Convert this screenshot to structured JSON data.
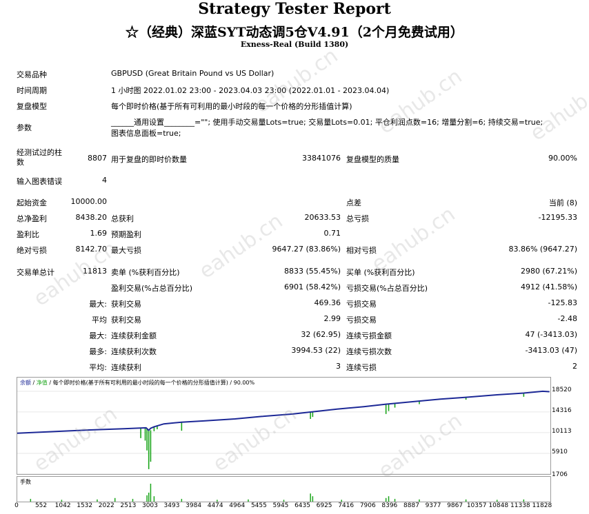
{
  "header": {
    "title": "Strategy Tester Report",
    "subtitle": "☆（经典）深蓝SYT动态调5仓V4.91（2个月免费试用）",
    "server": "Exness-Real (Build 1380)"
  },
  "info": {
    "symbol_label": "交易品种",
    "symbol_value": "GBPUSD (Great Britain Pound vs US Dollar)",
    "period_label": "时间周期",
    "period_value": "1 小时图 2022.01.02 23:00 - 2023.04.03 23:00 (2022.01.01 - 2023.04.04)",
    "model_label": "复盘模型",
    "model_value": "每个即时价格(基于所有可利用的最小时段的每一个价格的分形插值计算)",
    "params_label": "参数",
    "params_line1": "______通用设置________=\"\"; 使用手动交易量Lots=true; 交易量Lots=0.01; 平仓利润点数=16; 增量分割=6; 持续交易=true;",
    "params_line2": "图表信息面板=true;"
  },
  "stats": {
    "bars_label": "经测试过的柱\n数",
    "bars_value": "8807",
    "ticks_label": "用于复盘的即时价数量",
    "ticks_value": "33841076",
    "quality_label": "复盘模型的质量",
    "quality_value": "90.00%",
    "errors_label": "输入图表错误",
    "errors_value": "4",
    "deposit_label": "起始资金",
    "deposit_value": "10000.00",
    "spread_label": "点差",
    "spread_value": "当前 (8)",
    "net_label": "总净盈利",
    "net_value": "8438.20",
    "gross_profit_label": "总获利",
    "gross_profit_value": "20633.53",
    "gross_loss_label": "总亏损",
    "gross_loss_value": "-12195.33",
    "pf_label": "盈利比",
    "pf_value": "1.69",
    "payoff_label": "预期盈利",
    "payoff_value": "0.71",
    "abs_dd_label": "绝对亏损",
    "abs_dd_value": "8142.70",
    "max_dd_label": "最大亏损",
    "max_dd_value": "9647.27 (83.86%)",
    "rel_dd_label": "相对亏损",
    "rel_dd_value": "83.86% (9647.27)",
    "trades_label": "交易单总计",
    "trades_value": "11813",
    "short_label": "卖单 (%获利百分比)",
    "short_value": "8833 (55.45%)",
    "long_label": "买单 (%获利百分比)",
    "long_value": "2980 (67.21%)",
    "win_label": "盈利交易(%占总百分比)",
    "win_value": "6901 (58.42%)",
    "loss_label": "亏损交易(%占总百分比)",
    "loss_value": "4912 (41.58%)",
    "max_label": "最大:",
    "max_win_label": "获利交易",
    "max_win_value": "469.36",
    "max_loss_label": "亏损交易",
    "max_loss_value": "-125.83",
    "avg_label": "平均",
    "avg_win_label": "获利交易",
    "avg_win_value": "2.99",
    "avg_loss_label": "亏损交易",
    "avg_loss_value": "-2.48",
    "maxc_label": "最大:",
    "maxc_win_label": "连续获利金额",
    "maxc_win_value": "32 (62.95)",
    "maxc_loss_label": "连续亏损金额",
    "maxc_loss_value": "47 (-3413.03)",
    "most_label": "最多:",
    "most_win_label": "连续获利次数",
    "most_win_value": "3994.53 (22)",
    "most_loss_label": "连续亏损次数",
    "most_loss_value": "-3413.03 (47)",
    "avgc_label": "平均:",
    "avgc_win_label": "连续获利",
    "avgc_win_value": "3",
    "avgc_loss_label": "连续亏损",
    "avgc_loss_value": "2"
  },
  "chart_data": {
    "type": "line",
    "legend_balance": "余额",
    "legend_equity": "净值",
    "legend_rest": "/ 每个即时价格(基于所有可利用的最小时段的每一个价格的分形插值计算) / 90.00%",
    "volume_label": "手数",
    "y_ticks": [
      "18520",
      "14316",
      "10113",
      "5910",
      "1706"
    ],
    "y_tick_values": [
      18520,
      14316,
      10113,
      5910,
      1706
    ],
    "ylim": [
      1706,
      19900
    ],
    "x_ticks": [
      "0",
      "552",
      "1042",
      "1532",
      "2022",
      "2513",
      "3003",
      "3493",
      "3984",
      "4474",
      "4964",
      "5455",
      "5945",
      "6435",
      "6925",
      "7416",
      "7906",
      "8396",
      "8887",
      "9377",
      "9867",
      "10357",
      "10848",
      "11338",
      "11828"
    ],
    "xlim": [
      0,
      12000
    ],
    "balance_color": "#1c2896",
    "equity_color": "#1aa51a",
    "balance": [
      [
        0,
        10000
      ],
      [
        600,
        10250
      ],
      [
        1200,
        10500
      ],
      [
        1800,
        10720
      ],
      [
        2400,
        10900
      ],
      [
        2900,
        11100
      ],
      [
        2960,
        10600
      ],
      [
        3003,
        11000
      ],
      [
        3080,
        11300
      ],
      [
        3300,
        11900
      ],
      [
        3700,
        12250
      ],
      [
        4200,
        12500
      ],
      [
        4900,
        12900
      ],
      [
        5500,
        13400
      ],
      [
        6200,
        13900
      ],
      [
        6600,
        14300
      ],
      [
        7200,
        14900
      ],
      [
        7800,
        15400
      ],
      [
        8300,
        15900
      ],
      [
        8900,
        16400
      ],
      [
        9500,
        16900
      ],
      [
        10100,
        17300
      ],
      [
        10800,
        17800
      ],
      [
        11400,
        18150
      ],
      [
        11828,
        18520
      ],
      [
        11980,
        18430
      ]
    ],
    "equity_drops": [
      [
        2780,
        11000,
        9000
      ],
      [
        2880,
        10950,
        8500
      ],
      [
        2920,
        10900,
        6500
      ],
      [
        2960,
        10700,
        2700
      ],
      [
        3003,
        10600,
        4200
      ],
      [
        3080,
        11300,
        10400
      ],
      [
        3150,
        11600,
        10800
      ],
      [
        3700,
        12200,
        10500
      ],
      [
        6600,
        14300,
        12900
      ],
      [
        6650,
        14300,
        13300
      ],
      [
        8300,
        15900,
        13900
      ],
      [
        8360,
        15900,
        14500
      ],
      [
        8500,
        16000,
        15200
      ],
      [
        9050,
        16450,
        15900
      ],
      [
        10100,
        17200,
        16800
      ],
      [
        11400,
        18100,
        17400
      ]
    ],
    "volume_spikes": [
      [
        300,
        0.15
      ],
      [
        1000,
        0.1
      ],
      [
        1800,
        0.12
      ],
      [
        2200,
        0.2
      ],
      [
        2600,
        0.15
      ],
      [
        2920,
        0.35
      ],
      [
        2960,
        0.5
      ],
      [
        3003,
        1.0
      ],
      [
        3080,
        0.3
      ],
      [
        3700,
        0.15
      ],
      [
        4500,
        0.1
      ],
      [
        5200,
        0.12
      ],
      [
        6000,
        0.1
      ],
      [
        6600,
        0.45
      ],
      [
        6650,
        0.3
      ],
      [
        7300,
        0.1
      ],
      [
        8300,
        0.2
      ],
      [
        8360,
        0.3
      ],
      [
        8500,
        0.15
      ],
      [
        9050,
        0.12
      ],
      [
        10100,
        0.12
      ],
      [
        10800,
        0.1
      ],
      [
        11400,
        0.12
      ]
    ]
  }
}
